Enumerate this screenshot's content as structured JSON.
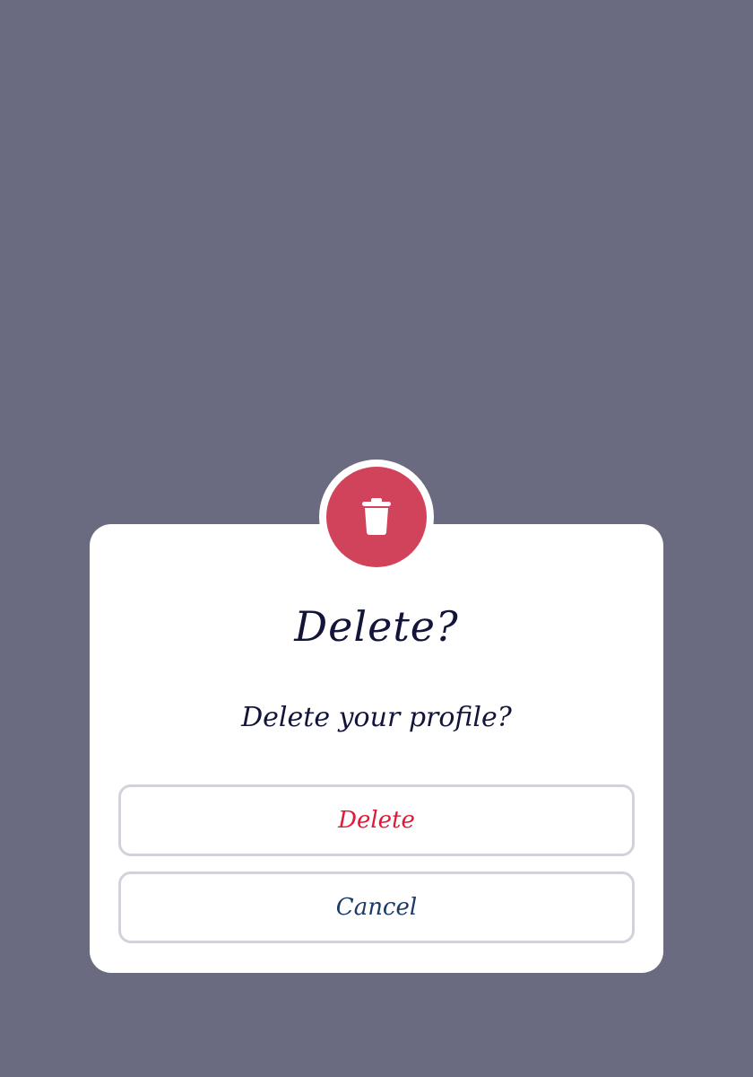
{
  "dialog": {
    "icon": "trash-icon",
    "title": "Delete?",
    "message": "Delete your profile?",
    "buttons": {
      "delete_label": "Delete",
      "cancel_label": "Cancel"
    }
  },
  "colors": {
    "backdrop": "#6a6b80",
    "accent": "#d1435b",
    "text": "#13143a",
    "delete_text": "#e31837",
    "cancel_text": "#1b3a66",
    "button_border": "#d2d2dc"
  }
}
